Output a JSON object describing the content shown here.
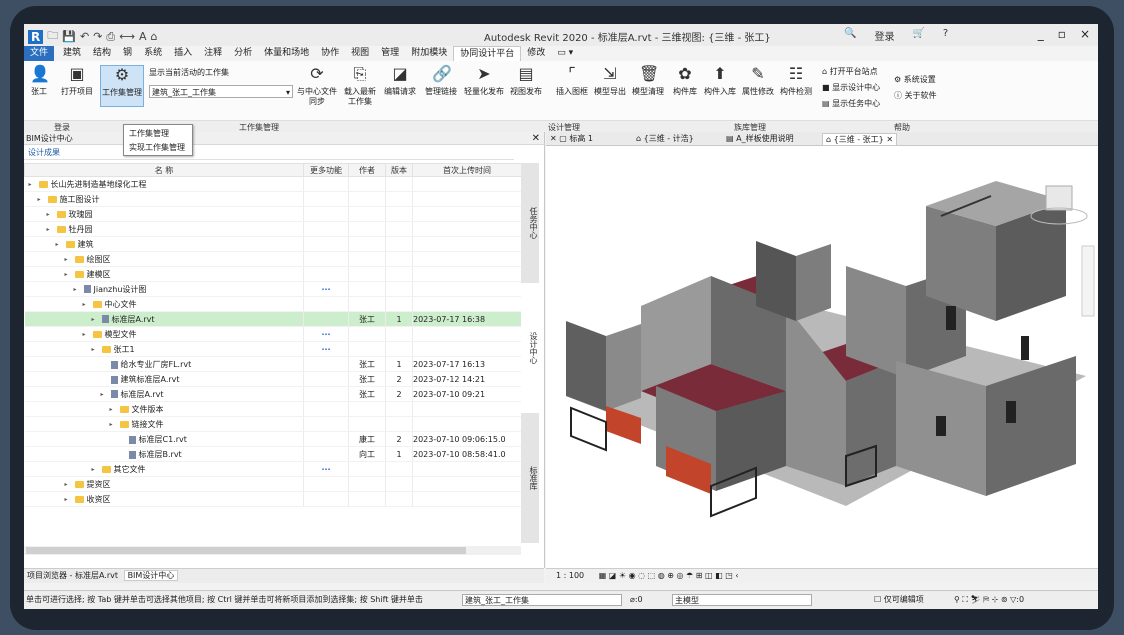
{
  "window": {
    "app_title": "Autodesk Revit 2020 - 标准层A.rvt - 三维视图: {三维 - 张工}",
    "login_label": "登录",
    "minimize": "_",
    "restore": "▫",
    "close": "×"
  },
  "menu": {
    "tabs": [
      "文件",
      "建筑",
      "结构",
      "钢",
      "系统",
      "插入",
      "注释",
      "分析",
      "体量和场地",
      "协作",
      "视图",
      "管理",
      "附加模块",
      "协同设计平台",
      "修改",
      "▭ ▾"
    ]
  },
  "ribbon": {
    "login_button": "张工",
    "open_project": "打开项目",
    "workset_mgmt": "工作集管理",
    "show_current_workset": "显示当前活动的工作集",
    "workset_value": "建筑_张工_工作集",
    "sync_center_line1": "与中心文件",
    "sync_center_line2": "同步",
    "load_latest_line1": "载入最新",
    "load_latest_line2": "工作集",
    "edit_request": "编辑请求",
    "manage_link": "管理链接",
    "light_publish": "轻量化发布",
    "view_publish": "视图发布",
    "insert_frame": "插入图框",
    "model_export": "模型导出",
    "model_cleanup": "模型清理",
    "component_lib": "构件库",
    "component_in": "构件入库",
    "attr_modify": "属性修改",
    "component_check": "构件检测",
    "open_platform": "打开平台站点",
    "show_design_center": "显示设计中心",
    "show_task_center": "显示任务中心",
    "system_settings": "系统设置",
    "about": "关于软件",
    "groups": [
      "登录",
      "工作集管理",
      "设计管理",
      "族库管理",
      "帮助"
    ]
  },
  "tooltip": {
    "title": "工作集管理",
    "desc": "实现工作集管理"
  },
  "left_panel": {
    "title": "BIM设计中心",
    "subtab": "设计成果",
    "columns": [
      "名 称",
      "更多功能",
      "作者",
      "版本",
      "首次上传时间"
    ],
    "rows": [
      {
        "name": "长山先进制造基地绿化工程",
        "more": "",
        "author": "",
        "ver": "",
        "time": ""
      },
      {
        "name": "施工图设计",
        "more": "",
        "author": "",
        "ver": "",
        "time": ""
      },
      {
        "name": "玫瑰园",
        "more": "",
        "author": "",
        "ver": "",
        "time": ""
      },
      {
        "name": "牡丹园",
        "more": "",
        "author": "",
        "ver": "",
        "time": ""
      },
      {
        "name": "建筑",
        "more": "",
        "author": "",
        "ver": "",
        "time": ""
      },
      {
        "name": "绘图区",
        "more": "",
        "author": "",
        "ver": "",
        "time": ""
      },
      {
        "name": "建模区",
        "more": "",
        "author": "",
        "ver": "",
        "time": ""
      },
      {
        "name": "Jianzhu设计图",
        "more": "···",
        "author": "",
        "ver": "",
        "time": ""
      },
      {
        "name": "中心文件",
        "more": "",
        "author": "",
        "ver": "",
        "time": ""
      },
      {
        "name": "标准层A.rvt",
        "more": "",
        "author": "张工",
        "ver": "1",
        "time": "2023-07-17 16:38"
      },
      {
        "name": "模型文件",
        "more": "···",
        "author": "",
        "ver": "",
        "time": ""
      },
      {
        "name": "张工1",
        "more": "···",
        "author": "",
        "ver": "",
        "time": ""
      },
      {
        "name": "给水专业厂房FL.rvt",
        "more": "",
        "author": "张工",
        "ver": "1",
        "time": "2023-07-17 16:13"
      },
      {
        "name": "建筑标准层A.rvt",
        "more": "",
        "author": "张工",
        "ver": "2",
        "time": "2023-07-12 14:21"
      },
      {
        "name": "标准层A.rvt",
        "more": "",
        "author": "张工",
        "ver": "2",
        "time": "2023-07-10 09:21"
      },
      {
        "name": "文件版本",
        "more": "",
        "author": "",
        "ver": "",
        "time": ""
      },
      {
        "name": "链接文件",
        "more": "",
        "author": "",
        "ver": "",
        "time": ""
      },
      {
        "name": "标准层C1.rvt",
        "more": "",
        "author": "康工",
        "ver": "2",
        "time": "2023-07-10 09:06:15.0"
      },
      {
        "name": "标准层B.rvt",
        "more": "",
        "author": "向工",
        "ver": "1",
        "time": "2023-07-10 08:58:41.0"
      },
      {
        "name": "其它文件",
        "more": "···",
        "author": "",
        "ver": "",
        "time": ""
      },
      {
        "name": "提资区",
        "more": "",
        "author": "",
        "ver": "",
        "time": ""
      },
      {
        "name": "收资区",
        "more": "",
        "author": "",
        "ver": "",
        "time": ""
      }
    ],
    "rail": [
      "任务中心",
      "设计中心",
      "标准库"
    ],
    "bottom_tabs": [
      "项目浏览器 - 标准层A.rvt",
      "BIM设计中心"
    ]
  },
  "view_tabs": [
    "标高 1",
    "{三维 - 计浩}",
    "A_样板使用说明",
    "{三维 - 张工}"
  ],
  "view_bar": {
    "scale": "1 : 100"
  },
  "status": {
    "hint": "单击可进行选择; 按 Tab 键并单击可选择其他项目; 按 Ctrl 键并单击可将新项目添加到选择集; 按 Shift 键并单击",
    "workset": "建筑_张工_工作集",
    "count": ":0",
    "model": "主模型",
    "editable_only": "仅可编辑项",
    "filter_count": ":0"
  },
  "colors": {
    "accent": "#2c6fbf",
    "highlight_row": "#cdeecd",
    "wall": "#6c6c6c",
    "floor": "#7a2b3a"
  }
}
